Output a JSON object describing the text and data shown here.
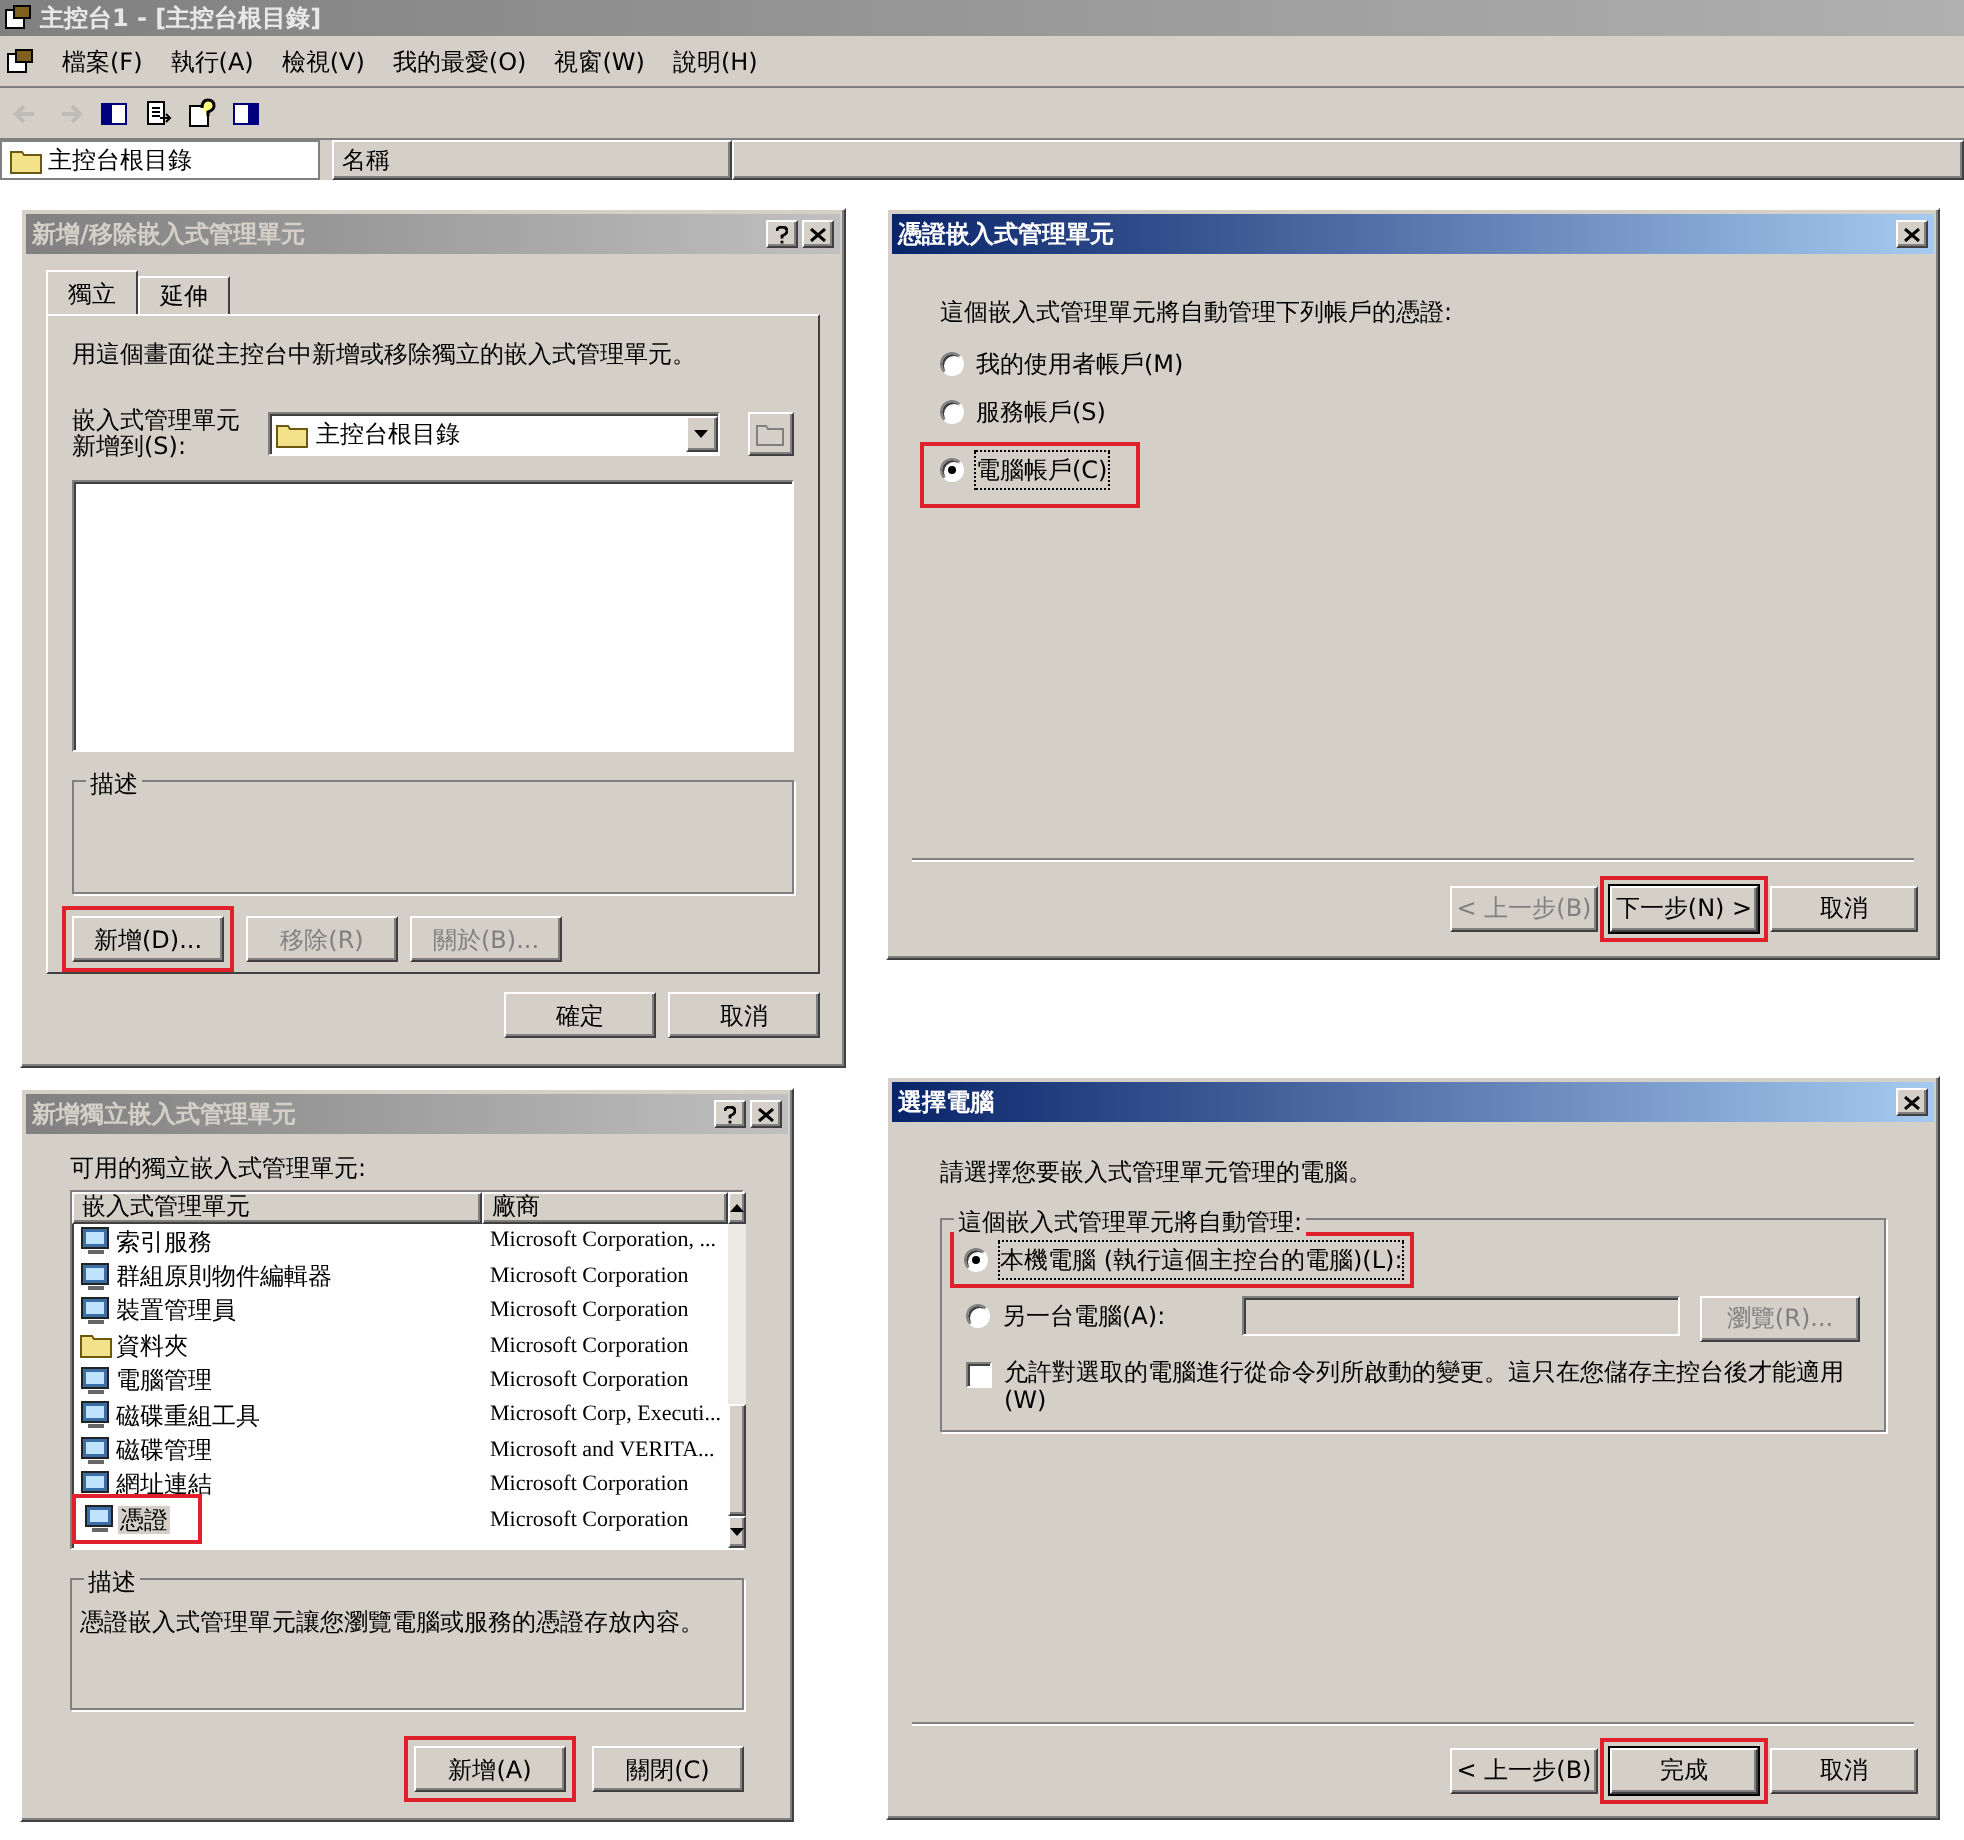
{
  "window": {
    "title": "主控台1 - [主控台根目錄]"
  },
  "menu_bar": [
    "檔案(F)",
    "執行(A)",
    "檢視(V)",
    "我的最愛(O)",
    "視窗(W)",
    "說明(H)"
  ],
  "toolbar": [
    {
      "kind": "back",
      "disabled": true
    },
    {
      "kind": "forward",
      "disabled": true
    },
    {
      "kind": "tree",
      "disabled": false
    },
    {
      "kind": "export",
      "disabled": false
    },
    {
      "kind": "help",
      "disabled": false
    },
    {
      "kind": "pane",
      "disabled": false
    }
  ],
  "tree": {
    "items": [
      {
        "label": "主控台根目錄"
      }
    ]
  },
  "list": {
    "columns": [
      "名稱"
    ]
  },
  "add_remove_dialog": {
    "title": "新增/移除嵌入式管理單元",
    "active": false,
    "tabs": [
      {
        "label": "獨立",
        "selected": true
      },
      {
        "label": "延伸",
        "selected": false
      }
    ],
    "intro": "用這個畫面從主控台中新增或移除獨立的嵌入式管理單元。",
    "target_label": [
      "嵌入式管理單元",
      "新增到(S):"
    ],
    "target_value": "主控台根目錄",
    "description_legend": "描述",
    "buttons": [
      {
        "label": "新增(D)...",
        "disabled": false,
        "highlighted": true
      },
      {
        "label": "移除(R)",
        "disabled": true,
        "highlighted": false
      },
      {
        "label": "關於(B)...",
        "disabled": true,
        "highlighted": false
      }
    ],
    "footer_buttons": [
      "確定",
      "取消"
    ]
  },
  "certificates_dialog": {
    "title": "憑證嵌入式管理單元",
    "active": true,
    "prompt": "這個嵌入式管理單元將自動管理下列帳戶的憑證:",
    "options": [
      {
        "label": "我的使用者帳戶(M)",
        "selected": false,
        "highlighted": false
      },
      {
        "label": "服務帳戶(S)",
        "selected": false,
        "highlighted": false
      },
      {
        "label": "電腦帳戶(C)",
        "selected": true,
        "highlighted": true
      }
    ],
    "buttons": [
      {
        "label": "< 上一步(B)",
        "disabled": true,
        "default": false,
        "highlighted": false
      },
      {
        "label": "下一步(N) >",
        "disabled": false,
        "default": true,
        "highlighted": true
      },
      {
        "label": "取消",
        "disabled": false,
        "default": false,
        "highlighted": false
      }
    ]
  },
  "add_standalone_dialog": {
    "title": "新增獨立嵌入式管理單元",
    "active": false,
    "list_label": "可用的獨立嵌入式管理單元:",
    "columns": [
      "嵌入式管理單元",
      "廠商"
    ],
    "rows": [
      {
        "name": "索引服務",
        "vendor": "Microsoft Corporation, ...",
        "selected": false,
        "highlighted": false
      },
      {
        "name": "群組原則物件編輯器",
        "vendor": "Microsoft Corporation",
        "selected": false,
        "highlighted": false
      },
      {
        "name": "裝置管理員",
        "vendor": "Microsoft Corporation",
        "selected": false,
        "highlighted": false
      },
      {
        "name": "資料夾",
        "vendor": "Microsoft Corporation",
        "selected": false,
        "highlighted": false
      },
      {
        "name": "電腦管理",
        "vendor": "Microsoft Corporation",
        "selected": false,
        "highlighted": false
      },
      {
        "name": "磁碟重組工具",
        "vendor": "Microsoft Corp, Executi...",
        "selected": false,
        "highlighted": false
      },
      {
        "name": "磁碟管理",
        "vendor": "Microsoft and VERITA...",
        "selected": false,
        "highlighted": false
      },
      {
        "name": "網址連結",
        "vendor": "Microsoft Corporation",
        "selected": false,
        "highlighted": false
      },
      {
        "name": "憑證",
        "vendor": "Microsoft Corporation",
        "selected": true,
        "highlighted": true
      }
    ],
    "description_legend": "描述",
    "description": "憑證嵌入式管理單元讓您瀏覽電腦或服務的憑證存放內容。",
    "buttons": [
      {
        "label": "新增(A)",
        "highlighted": true
      },
      {
        "label": "關閉(C)",
        "highlighted": false
      }
    ]
  },
  "select_computer_dialog": {
    "title": "選擇電腦",
    "active": true,
    "prompt": "請選擇您要嵌入式管理單元管理的電腦。",
    "group_legend": "這個嵌入式管理單元將自動管理:",
    "options": [
      {
        "label": "本機電腦 (執行這個主控台的電腦)(L):",
        "selected": true,
        "highlighted": true
      },
      {
        "label": "另一台電腦(A):",
        "selected": false,
        "highlighted": false
      }
    ],
    "browse_button": {
      "label": "瀏覽(R)...",
      "disabled": true
    },
    "allow_change": {
      "label": "允許對選取的電腦進行從命令列所啟動的變更。這只在您儲存主控台後才能適用(W)",
      "checked": false
    },
    "buttons": [
      {
        "label": "< 上一步(B)",
        "disabled": false,
        "default": false,
        "highlighted": false
      },
      {
        "label": "完成",
        "disabled": false,
        "default": true,
        "highlighted": true
      },
      {
        "label": "取消",
        "disabled": false,
        "default": false,
        "highlighted": false
      }
    ]
  }
}
